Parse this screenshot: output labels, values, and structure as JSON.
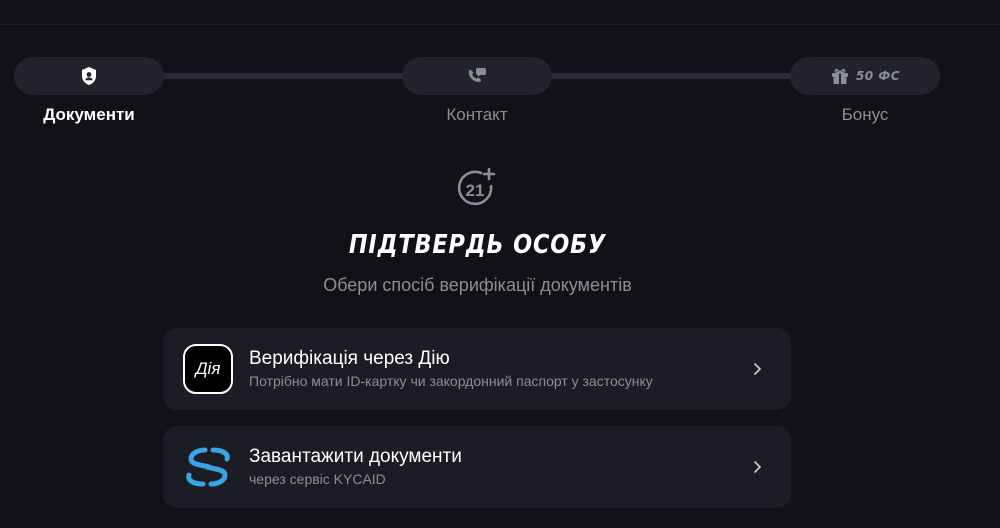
{
  "stepper": {
    "steps": [
      {
        "label": "Документи",
        "icon": "shield-user-icon",
        "active": true
      },
      {
        "label": "Контакт",
        "icon": "phone-chat-icon",
        "active": false
      },
      {
        "label": "Бонус",
        "icon": "gift-icon",
        "badge": "50 ФС",
        "active": false
      }
    ]
  },
  "header": {
    "icon": "age-21-plus-icon",
    "title": "ПІДТВЕРДЬ ОСОБУ",
    "subtitle": "Обери спосіб верифікації документів"
  },
  "options": [
    {
      "icon_text": "Дія",
      "title": "Верифікація через Дію",
      "subtitle": "Потрібно мати ID-картку чи закордонний паспорт у застосунку"
    },
    {
      "icon": "kycaid-logo-icon",
      "title": "Завантажити документи",
      "subtitle": "через сервіс KYCAID"
    }
  ],
  "colors": {
    "background": "#111117",
    "card": "#1c1d24",
    "muted_text": "#8b8d98",
    "kycaid_blue": "#3aa3e3"
  }
}
